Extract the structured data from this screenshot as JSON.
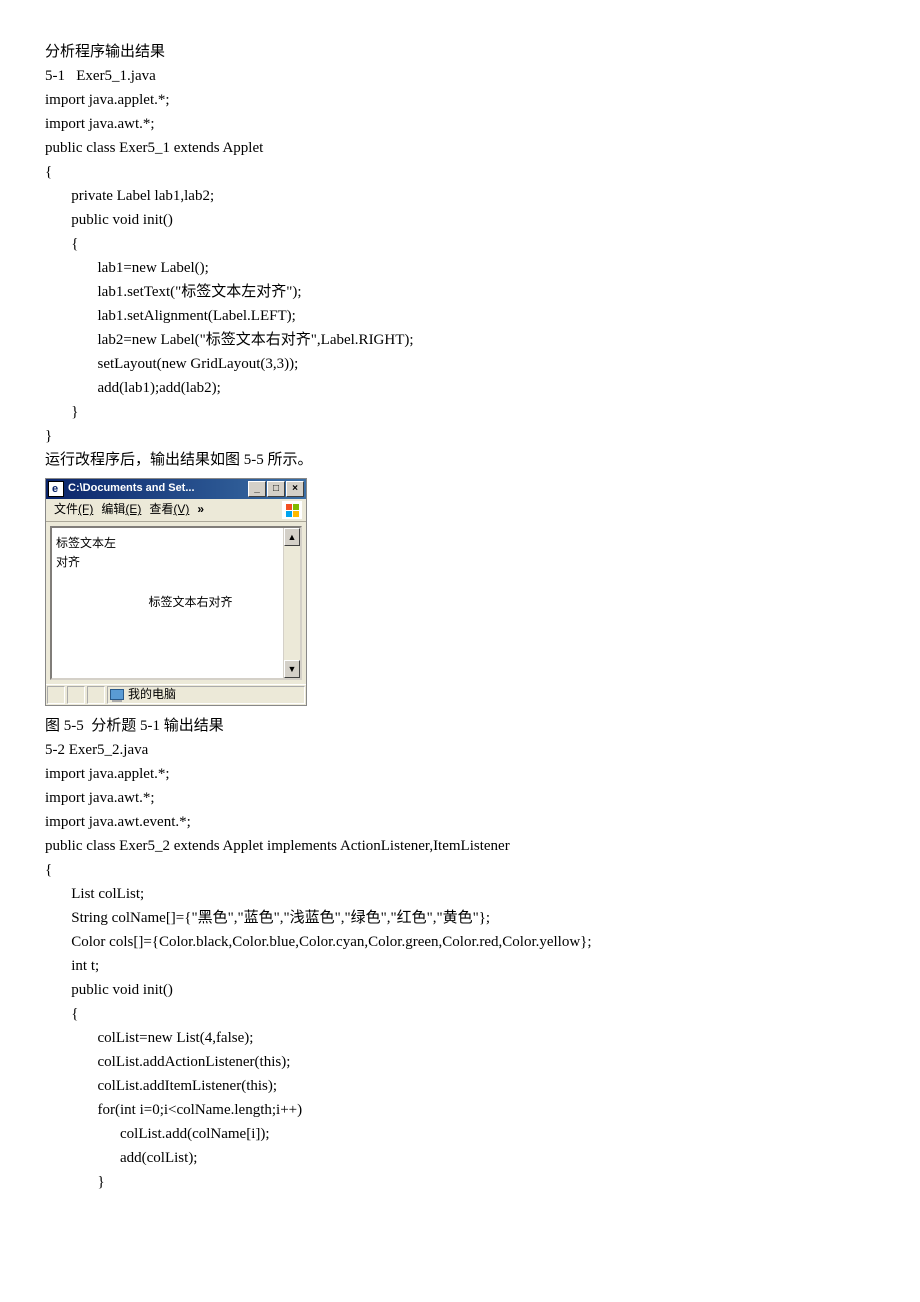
{
  "doc": {
    "heading": "分析程序输出结果",
    "ex1_title": "5-1   Exer5_1.java",
    "code1": [
      "import java.applet.*;",
      "import java.awt.*;",
      "",
      "public class Exer5_1 extends Applet",
      "{",
      "       private Label lab1,lab2;",
      "       public void init()",
      "       {",
      "              lab1=new Label();",
      "              lab1.setText(\"标签文本左对齐\");",
      "              lab1.setAlignment(Label.LEFT);",
      "              lab2=new Label(\"标签文本右对齐\",Label.RIGHT);",
      "              setLayout(new GridLayout(3,3));",
      "              add(lab1);add(lab2);",
      "       }",
      "}"
    ],
    "run_text": "运行改程序后，输出结果如图 5-5 所示。",
    "fig_caption": "图 5-5  分析题 5-1 输出结果",
    "ex2_title": "5-2 Exer5_2.java",
    "code2": [
      "import java.applet.*;",
      "import java.awt.*;",
      "import java.awt.event.*;",
      "public class Exer5_2 extends Applet implements ActionListener,ItemListener",
      "{",
      "       List colList;",
      "       String colName[]={\"黑色\",\"蓝色\",\"浅蓝色\",\"绿色\",\"红色\",\"黄色\"};",
      "       Color cols[]={Color.black,Color.blue,Color.cyan,Color.green,Color.red,Color.yellow};",
      "       int t;",
      "       public void init()",
      "       {",
      "              colList=new List(4,false);",
      "              colList.addActionListener(this);",
      "              colList.addItemListener(this);",
      "              for(int i=0;i<colName.length;i++)",
      "                    colList.add(colName[i]);",
      "                    add(colList);",
      "              }"
    ]
  },
  "applet": {
    "title": "C:\\Documents and Set...",
    "menu_file": "文件",
    "menu_file_u": "(F)",
    "menu_edit": "编辑",
    "menu_edit_u": "(E)",
    "menu_view": "查看",
    "menu_view_u": "(V)",
    "menu_more": "»",
    "label_left": "标签文本左对齐",
    "label_right": "标签文本右对齐",
    "status": "我的电脑",
    "btn_min": "_",
    "btn_max": "□",
    "btn_close": "×",
    "arrow_up": "▲",
    "arrow_down": "▼"
  }
}
